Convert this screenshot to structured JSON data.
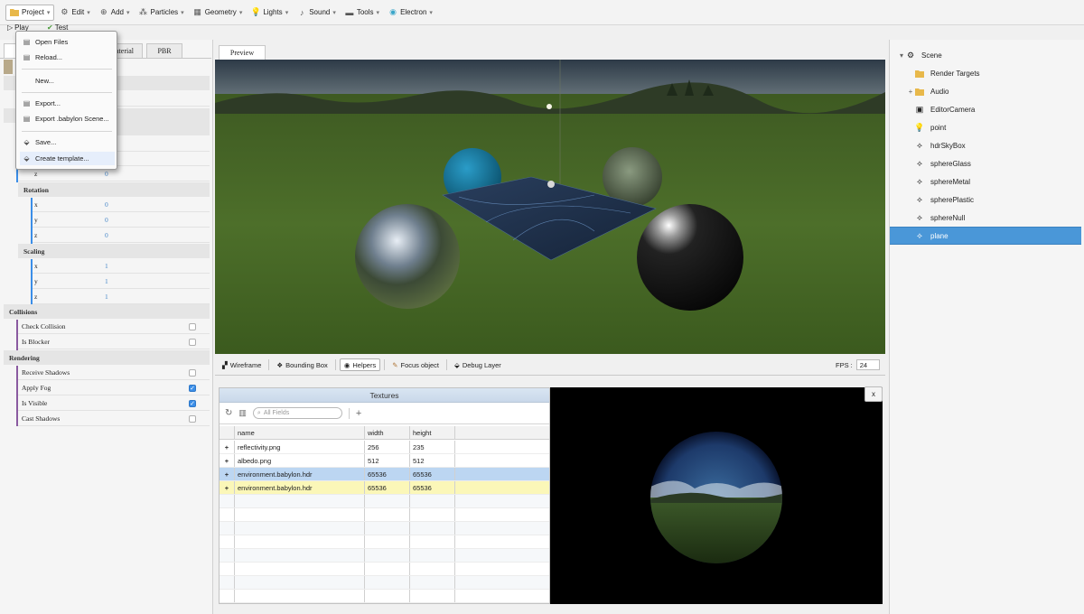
{
  "menubar": {
    "items": [
      {
        "label": "Project",
        "icon": "folder-icon"
      },
      {
        "label": "Edit",
        "icon": "gear-icon"
      },
      {
        "label": "Add",
        "icon": "plus-circle-icon"
      },
      {
        "label": "Particles",
        "icon": "particles-icon"
      },
      {
        "label": "Geometry",
        "icon": "geometry-icon"
      },
      {
        "label": "Lights",
        "icon": "bulb-icon"
      },
      {
        "label": "Sound",
        "icon": "sound-icon"
      },
      {
        "label": "Tools",
        "icon": "tools-icon"
      },
      {
        "label": "Electron",
        "icon": "electron-icon"
      }
    ]
  },
  "subbar": {
    "play": "Play",
    "test": "Test"
  },
  "dropdown": {
    "open_files": "Open Files",
    "reload": "Reload...",
    "new": "New...",
    "export": "Export...",
    "export_babylon": "Export .babylon Scene...",
    "save": "Save...",
    "create_template": "Create template..."
  },
  "leftpanel": {
    "tabs": [
      "aterial",
      "PBR"
    ],
    "position_z": "z",
    "position_z_value": "0",
    "rotation_title": "Rotation",
    "rotation": [
      {
        "axis": "x",
        "value": "0"
      },
      {
        "axis": "y",
        "value": "0"
      },
      {
        "axis": "z",
        "value": "0"
      }
    ],
    "scaling_title": "Scaling",
    "scaling": [
      {
        "axis": "x",
        "value": "1"
      },
      {
        "axis": "y",
        "value": "1"
      },
      {
        "axis": "z",
        "value": "1"
      }
    ],
    "collisions_title": "Collisions",
    "collisions": [
      {
        "label": "Check Collision",
        "checked": false
      },
      {
        "label": "Is Blocker",
        "checked": false
      }
    ],
    "rendering_title": "Rendering",
    "rendering": [
      {
        "label": "Receive Shadows",
        "checked": false
      },
      {
        "label": "Apply Fog",
        "checked": true
      },
      {
        "label": "Is Visible",
        "checked": true
      },
      {
        "label": "Cast Shadows",
        "checked": false
      }
    ]
  },
  "preview": {
    "tab": "Preview",
    "toolbar": {
      "wireframe": "Wireframe",
      "bounding_box": "Bounding Box",
      "helpers": "Helpers",
      "focus_object": "Focus object",
      "debug_layer": "Debug Layer"
    },
    "fps_label": "FPS :",
    "fps_value": "24"
  },
  "textures": {
    "title": "Textures",
    "search_placeholder": "All Fields",
    "columns": [
      "name",
      "width",
      "height"
    ],
    "rows": [
      {
        "name": "reflectivity.png",
        "width": "256",
        "height": "235",
        "state": "normal"
      },
      {
        "name": "albedo.png",
        "width": "512",
        "height": "512",
        "state": "normal"
      },
      {
        "name": "environment.babylon.hdr",
        "width": "65536",
        "height": "65536",
        "state": "selected"
      },
      {
        "name": "environment.babylon.hdr",
        "width": "65536",
        "height": "65536",
        "state": "hover"
      }
    ],
    "close_label": "x"
  },
  "scenetree": {
    "items": [
      {
        "label": "Scene",
        "icon": "scene-icon",
        "expander": "▾",
        "level": 0
      },
      {
        "label": "Render Targets",
        "icon": "folder-icon",
        "expander": "",
        "level": 1
      },
      {
        "label": "Audio",
        "icon": "folder-icon",
        "expander": "+",
        "level": 1
      },
      {
        "label": "EditorCamera",
        "icon": "camera-icon",
        "expander": "",
        "level": 1
      },
      {
        "label": "point",
        "icon": "light-icon",
        "expander": "",
        "level": 1
      },
      {
        "label": "hdrSkyBox",
        "icon": "mesh-icon",
        "expander": "",
        "level": 1
      },
      {
        "label": "sphereGlass",
        "icon": "mesh-icon",
        "expander": "",
        "level": 1
      },
      {
        "label": "sphereMetal",
        "icon": "mesh-icon",
        "expander": "",
        "level": 1
      },
      {
        "label": "spherePlastic",
        "icon": "mesh-icon",
        "expander": "",
        "level": 1
      },
      {
        "label": "sphereNull",
        "icon": "mesh-icon",
        "expander": "",
        "level": 1
      },
      {
        "label": "plane",
        "icon": "mesh-icon",
        "expander": "",
        "level": 1,
        "selected": true
      }
    ]
  },
  "colors": {
    "accent": "#4a97d8",
    "value_blue": "#4a89c9",
    "row_selected": "#bcd6f2",
    "row_hover": "#fbf7b8"
  }
}
